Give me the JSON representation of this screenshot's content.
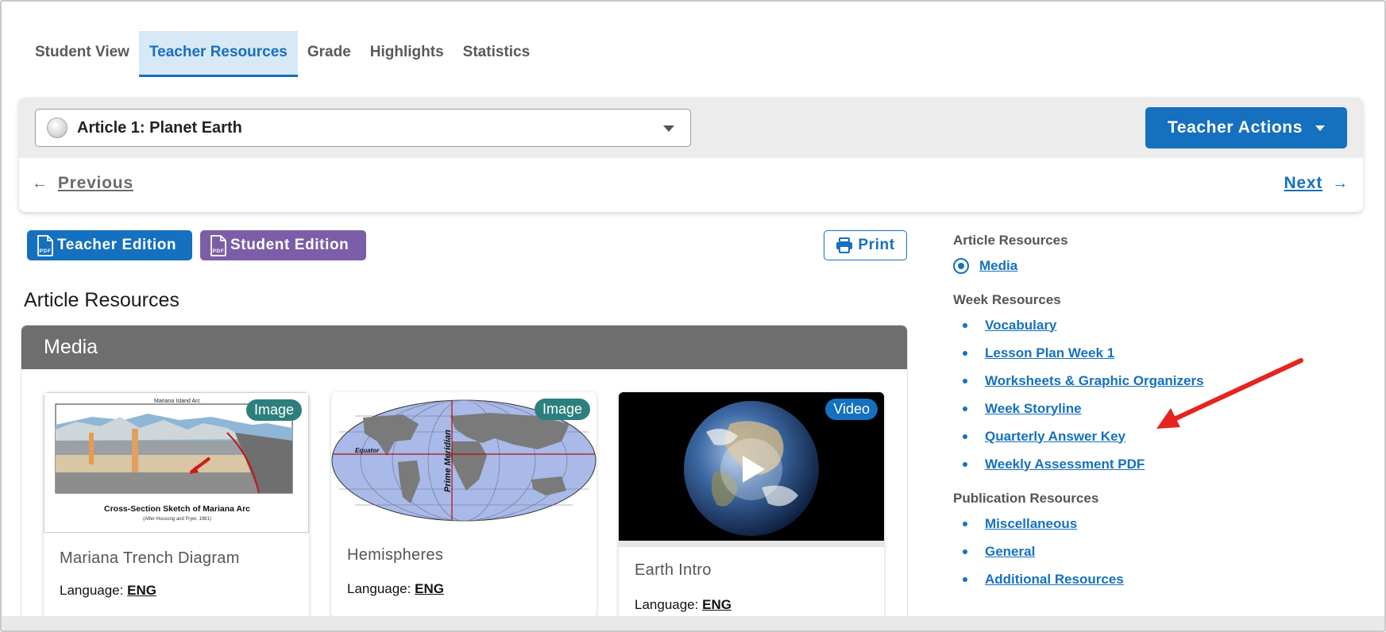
{
  "tabs": [
    {
      "label": "Student View",
      "active": false
    },
    {
      "label": "Teacher Resources",
      "active": true
    },
    {
      "label": "Grade",
      "active": false
    },
    {
      "label": "Highlights",
      "active": false
    },
    {
      "label": "Statistics",
      "active": false
    }
  ],
  "header": {
    "article_select": "Article 1: Planet Earth",
    "teacher_actions": "Teacher Actions",
    "previous": "Previous",
    "next": "Next"
  },
  "editions": {
    "teacher": "Teacher Edition",
    "student": "Student Edition",
    "print": "Print",
    "pdf_icon_text": "PDF"
  },
  "main": {
    "section_title": "Article Resources",
    "media_header": "Media",
    "language_label": "Language:",
    "cards": [
      {
        "type": "Image",
        "name": "Mariana Trench Diagram",
        "language": "ENG",
        "thumb_caption": "Cross-Section Sketch of Mariana Arc",
        "thumb_subcaption": "(After Hussong and Fryer, 1981)",
        "thumb_top_label": "Mariana Island Arc"
      },
      {
        "type": "Image",
        "name": "Hemispheres",
        "language": "ENG",
        "thumb_equator": "Equator",
        "thumb_meridian": "Prime Meridian"
      },
      {
        "type": "Video",
        "name": "Earth Intro",
        "language": "ENG"
      }
    ]
  },
  "sidebar": {
    "article_heading": "Article Resources",
    "article_items": [
      "Media"
    ],
    "week_heading": "Week Resources",
    "week_items": [
      "Vocabulary",
      "Lesson Plan Week 1",
      "Worksheets & Graphic Organizers",
      "Week Storyline",
      "Quarterly Answer Key",
      "Weekly Assessment PDF"
    ],
    "publication_heading": "Publication Resources",
    "publication_items": [
      "Miscellaneous",
      "General",
      "Additional Resources"
    ]
  },
  "colors": {
    "primary": "#1570bf",
    "student_edition": "#7b5ea7",
    "image_badge": "#2c7f7d",
    "media_header": "#6e6e6e",
    "annotation_arrow": "#e52420"
  }
}
